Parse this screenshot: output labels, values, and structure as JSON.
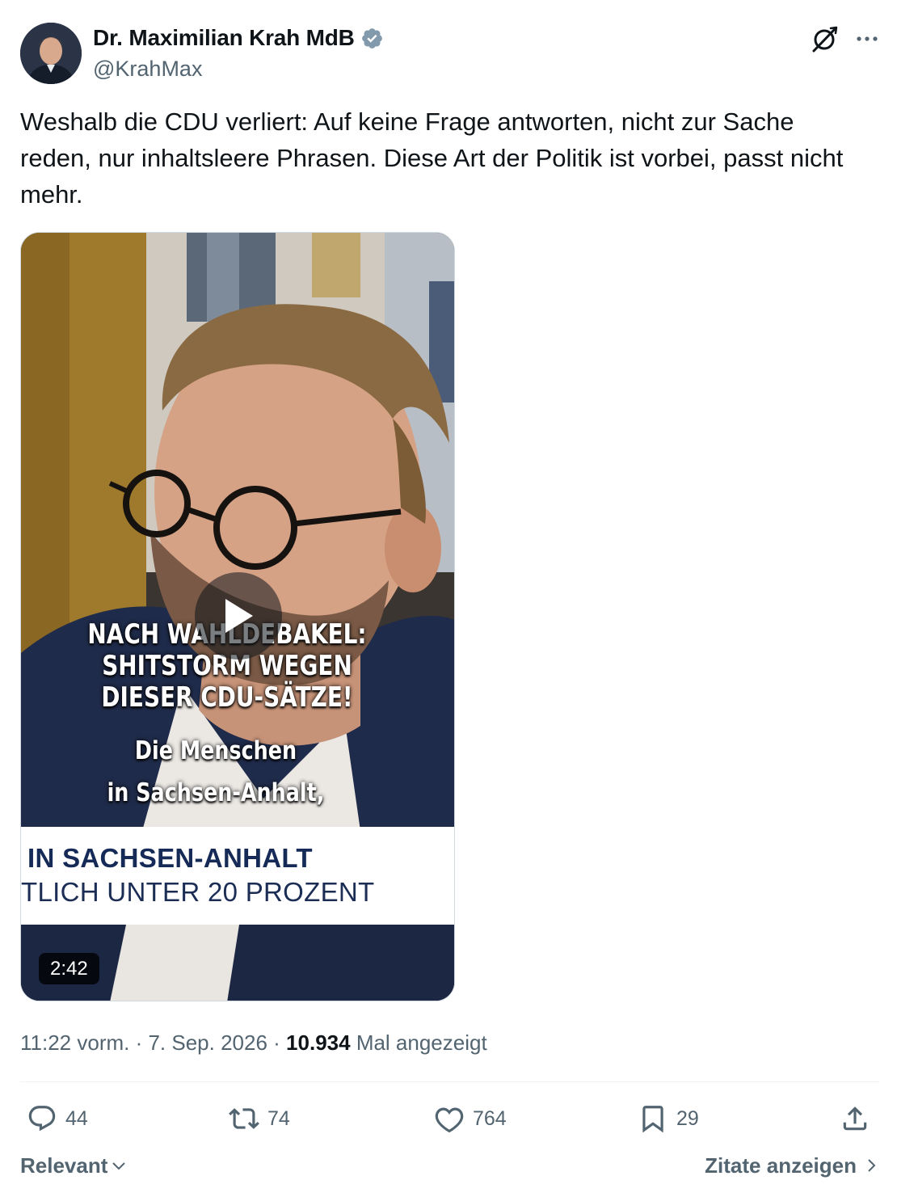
{
  "author": {
    "name": "Dr. Maximilian Krah MdB",
    "handle": "@KrahMax",
    "verified_icon": "verified-badge-icon"
  },
  "header": {
    "grok_icon": "grok-icon",
    "more_icon": "more-dots-icon"
  },
  "tweet": {
    "text": "Weshalb die CDU verliert: Auf keine Frage antworten, nicht zur Sache reden, nur inhaltsleere Phrasen. Diese Art der Politik ist vorbei, passt nicht mehr."
  },
  "video": {
    "caption_line1": "NACH WAHLDEBAKEL:",
    "caption_line2": "SHITSTORM WEGEN",
    "caption_line3": "DIESER CDU-SÄTZE!",
    "subtitle_line1": "Die Menschen",
    "subtitle_line2": "in Sachsen-Anhalt,",
    "lower_third_line1": "IN SACHSEN-ANHALT",
    "lower_third_line2": "TLICH UNTER 20 PROZENT",
    "duration": "2:42",
    "play_icon": "play-icon"
  },
  "meta": {
    "time": "11:22 vorm.",
    "separator": " · ",
    "date": "7. Sep. 2026",
    "views": "10.934",
    "views_label": "Mal angezeigt"
  },
  "actions": {
    "replies": "44",
    "reposts": "74",
    "likes": "764",
    "bookmarks": "29"
  },
  "footer": {
    "sort_label": "Relevant",
    "quotes_label": "Zitate anzeigen"
  },
  "colors": {
    "text_primary": "#0f1419",
    "text_secondary": "#536471",
    "verified": "#829aab",
    "divider": "#eff3f4"
  }
}
